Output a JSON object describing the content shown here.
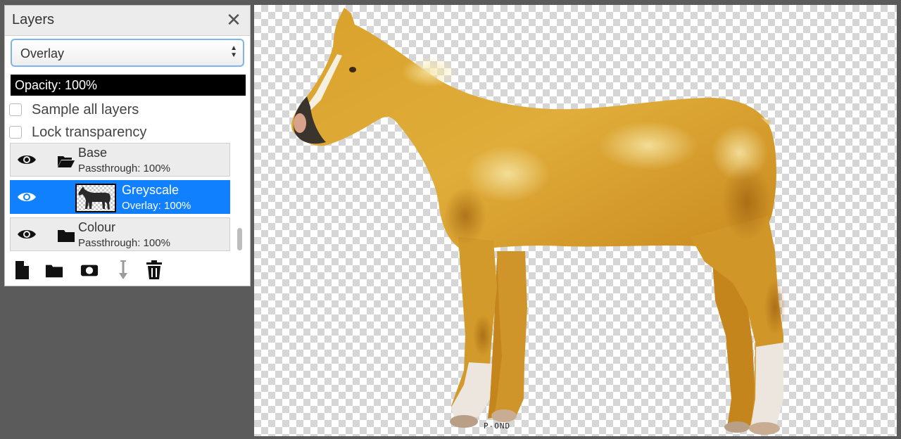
{
  "panel": {
    "title": "Layers",
    "close_glyph": "✕",
    "blend_mode": {
      "selected": "Overlay"
    },
    "opacity_label": "Opacity: 100%",
    "opacity_value": 1.0,
    "options": [
      {
        "label": "Sample all layers",
        "checked": false
      },
      {
        "label": "Lock transparency",
        "checked": false
      }
    ],
    "layers": [
      {
        "name": "Base",
        "detail": "Passthrough: 100%",
        "type": "group",
        "icon": "folder-open-icon",
        "visible": true,
        "selected": false
      },
      {
        "name": "Greyscale",
        "detail": "Overlay: 100%",
        "type": "image",
        "icon": "layer-thumbnail",
        "visible": true,
        "selected": true
      },
      {
        "name": "Colour",
        "detail": "Passthrough: 100%",
        "type": "group",
        "icon": "folder-icon",
        "visible": true,
        "selected": false
      }
    ],
    "toolbar": [
      {
        "icon": "new-layer-icon"
      },
      {
        "icon": "new-group-icon"
      },
      {
        "icon": "add-mask-icon"
      },
      {
        "icon": "merge-down-icon"
      },
      {
        "icon": "delete-layer-icon"
      }
    ]
  },
  "canvas": {
    "watermark": "P-OND",
    "colors": {
      "coat": "#d9a12b",
      "coat_dark": "#a86e12",
      "highlight": "#f1dc95",
      "socks": "#ece6df"
    }
  },
  "colors": {
    "selection": "#1080ff",
    "focus_ring": "#7db4f0",
    "workspace": "#5b5b5b"
  }
}
